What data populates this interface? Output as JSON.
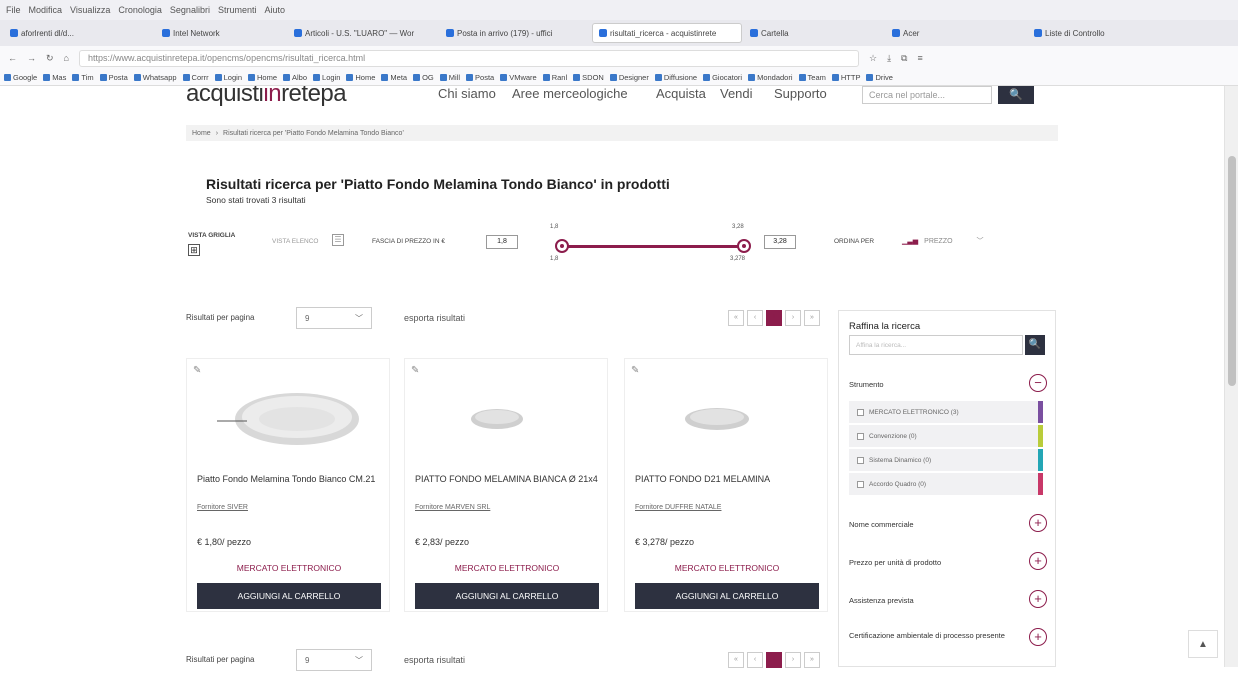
{
  "browser": {
    "menubar": [
      "File",
      "Modifica",
      "Visualizza",
      "Cronologia",
      "Segnalibri",
      "Strumenti",
      "Aiuto"
    ],
    "tabs": [
      {
        "label": "aforlrenti dl/d...",
        "active": false
      },
      {
        "label": "Intel Network",
        "active": false
      },
      {
        "label": "Articoli - U.S. \"LUARO\" — Wor",
        "active": false
      },
      {
        "label": "Posta in arrivo (179) - uffici",
        "active": false
      },
      {
        "label": "risultati_ricerca - acquistinrete",
        "active": true
      },
      {
        "label": "Cartella",
        "active": false
      },
      {
        "label": "Acer",
        "active": false
      },
      {
        "label": "Liste di Controllo",
        "active": false
      }
    ],
    "url": "https://www.acquistinretepa.it/opencms/opencms/risultati_ricerca.html",
    "bookmarks": [
      "Google",
      "Mas",
      "Tim",
      "Posta",
      "Whatsapp",
      "Corrr",
      "Login",
      "Home",
      "Albo",
      "Login",
      "Home",
      "Meta",
      "OG",
      "Mill",
      "Posta",
      "VMware",
      "Ranl",
      "SDON",
      "Designer",
      "Diffusione",
      "Giocatori",
      "Mondadori",
      "Team",
      "HTTP",
      "Drive"
    ]
  },
  "site": {
    "logo_left": "acquisti",
    "logo_mid": "in",
    "logo_right": "retepa",
    "nav": [
      "Chi siamo",
      "Aree merceologiche",
      "Acquista",
      "Vendi",
      "Supporto"
    ],
    "search_placeholder": "Cerca nel portale...",
    "search_icon": "search-icon"
  },
  "breadcrumb": {
    "home": "Home",
    "sep": "›",
    "current": "Risultati ricerca per 'Piatto Fondo Melamina Tondo Bianco'"
  },
  "results": {
    "title": "Risultati ricerca per 'Piatto Fondo Melamina Tondo Bianco' in prodotti",
    "count_text": "Sono stati trovati 3 risultati"
  },
  "filters": {
    "view_grid_label": "VISTA GRIGLIA",
    "view_list_label": "VISTA ELENCO",
    "price_label": "FASCIA DI PREZZO IN €",
    "min_value": "1,8",
    "max_value": "3,28",
    "slider_min_top": "1,8",
    "slider_max_top": "3,28",
    "slider_min_bottom": "1,8",
    "slider_max_bottom": "3,278",
    "sort_label": "ORDINA PER",
    "sort_value": "PREZZO"
  },
  "controls": {
    "per_page_label": "Risultati per pagina",
    "per_page_value": "9",
    "export_label": "esporta risultati",
    "page_current": "1"
  },
  "products": [
    {
      "title": "Piatto Fondo Melamina Tondo Bianco CM.21",
      "supplier": "Fornitore SIVER",
      "price": "€ 1,80/ pezzo",
      "market": "MERCATO ELETTRONICO",
      "cart": "AGGIUNGI AL CARRELLO"
    },
    {
      "title": "PIATTO FONDO MELAMINA BIANCA Ø 21x4",
      "supplier": "Fornitore MARVEN SRL",
      "price": "€ 2,83/ pezzo",
      "market": "MERCATO ELETTRONICO",
      "cart": "AGGIUNGI AL CARRELLO"
    },
    {
      "title": "PIATTO FONDO D21 MELAMINA",
      "supplier": "Fornitore DUFFRE NATALE",
      "price": "€ 3,278/ pezzo",
      "market": "MERCATO ELETTRONICO",
      "cart": "AGGIUNGI AL CARRELLO"
    }
  ],
  "refine": {
    "title": "Raffina la ricerca",
    "input_placeholder": "Affina la ricerca...",
    "facets": [
      "Strumento",
      "Nome commerciale",
      "Prezzo per unità di prodotto",
      "Assistenza prevista",
      "Certificazione ambientale di processo presente"
    ],
    "options": [
      {
        "label": "MERCATO ELETTRONICO (3)",
        "color": "#7a4fa0"
      },
      {
        "label": "Convenzione (0)",
        "color": "#b9cc3a"
      },
      {
        "label": "Sistema Dinamico (0)",
        "color": "#23a6b5"
      },
      {
        "label": "Accordo Quadro (0)",
        "color": "#c83868"
      }
    ]
  },
  "colors": {
    "accent": "#8c1d4c",
    "dark": "#2d3140"
  }
}
